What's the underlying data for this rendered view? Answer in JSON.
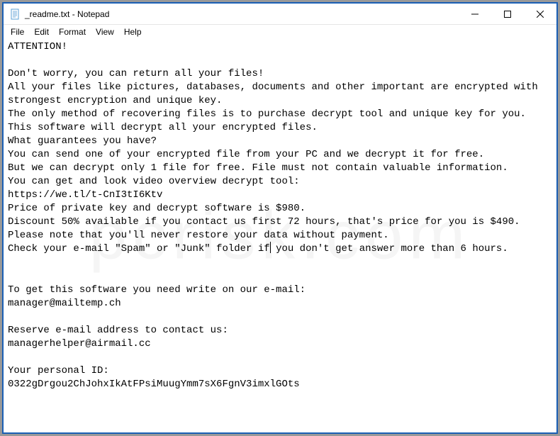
{
  "window": {
    "title": "_readme.txt - Notepad"
  },
  "menu": {
    "file": "File",
    "edit": "Edit",
    "format": "Format",
    "view": "View",
    "help": "Help"
  },
  "content": {
    "l1": "ATTENTION!",
    "l2": "",
    "l3": "Don't worry, you can return all your files!",
    "l4": "All your files like pictures, databases, documents and other important are encrypted with strongest encryption and unique key.",
    "l5": "The only method of recovering files is to purchase decrypt tool and unique key for you.",
    "l6": "This software will decrypt all your encrypted files.",
    "l7": "What guarantees you have?",
    "l8": "You can send one of your encrypted file from your PC and we decrypt it for free.",
    "l9": "But we can decrypt only 1 file for free. File must not contain valuable information.",
    "l10": "You can get and look video overview decrypt tool:",
    "l11": "https://we.tl/t-CnI3tI6Ktv",
    "l12": "Price of private key and decrypt software is $980.",
    "l13": "Discount 50% available if you contact us first 72 hours, that's price for you is $490.",
    "l14": "Please note that you'll never restore your data without payment.",
    "l15a": "Check your e-mail \"Spam\" or \"Junk\" folder if",
    "l15b": " you don't get answer more than 6 hours.",
    "l16": "",
    "l17": "",
    "l18": "To get this software you need write on our e-mail:",
    "l19": "manager@mailtemp.ch",
    "l20": "",
    "l21": "Reserve e-mail address to contact us:",
    "l22": "managerhelper@airmail.cc",
    "l23": "",
    "l24": "Your personal ID:",
    "l25": "0322gDrgou2ChJohxIkAtFPsiMuugYmm7sX6FgnV3imxlGOts"
  },
  "watermark": "pcrisk.com"
}
